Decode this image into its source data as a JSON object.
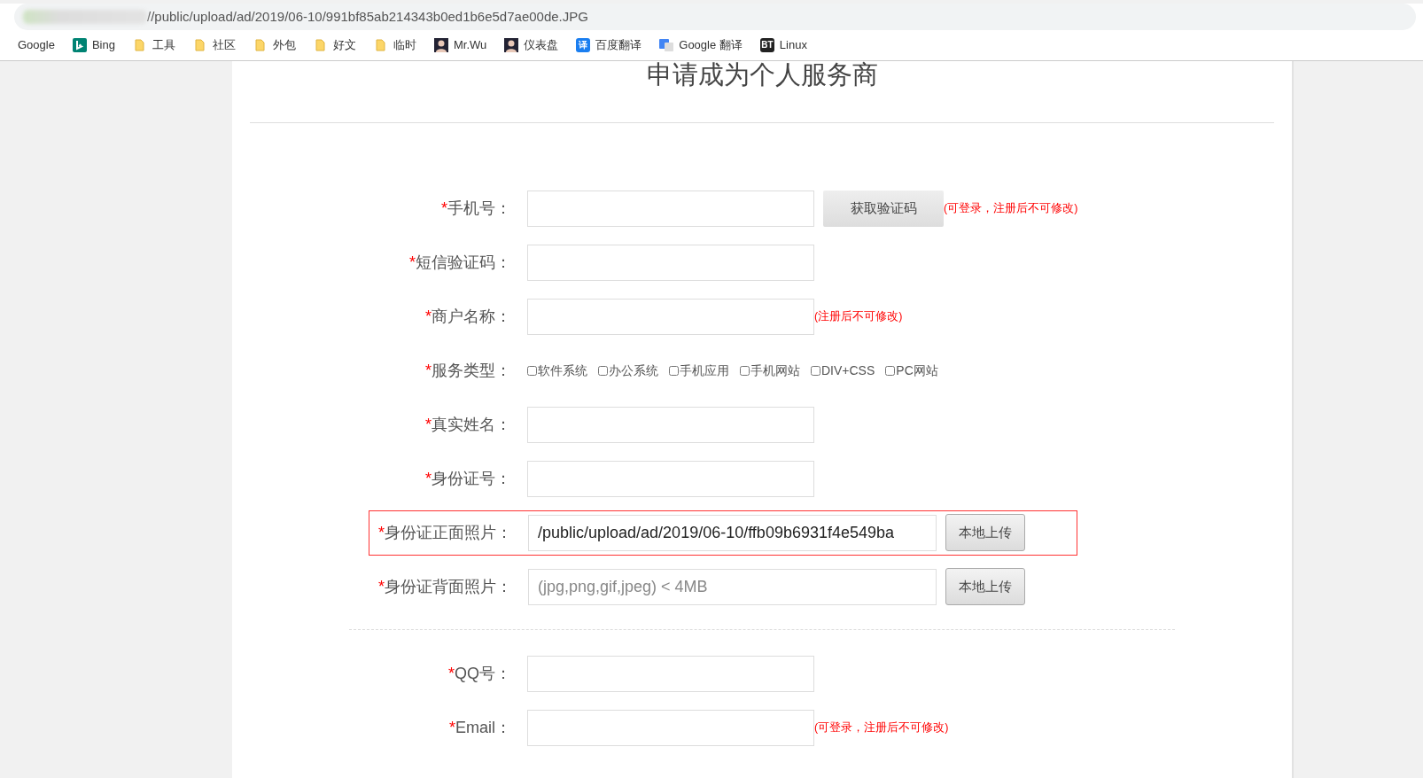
{
  "browser": {
    "url": "//public/upload/ad/2019/06-10/991bf85ab214343b0ed1b6e5d7ae00de.JPG",
    "bookmarks": [
      {
        "label": "Google",
        "kind": "plain"
      },
      {
        "label": "Bing",
        "kind": "bing"
      },
      {
        "label": "工具",
        "kind": "folder"
      },
      {
        "label": "社区",
        "kind": "folder"
      },
      {
        "label": "外包",
        "kind": "folder"
      },
      {
        "label": "好文",
        "kind": "folder"
      },
      {
        "label": "临时",
        "kind": "folder"
      },
      {
        "label": "Mr.Wu",
        "kind": "avatar"
      },
      {
        "label": "仪表盘",
        "kind": "avatar"
      },
      {
        "label": "百度翻译",
        "kind": "translate",
        "icon_text": "译"
      },
      {
        "label": "Google 翻译",
        "kind": "gtranslate"
      },
      {
        "label": "Linux",
        "kind": "terminal",
        "icon_text": "BT"
      }
    ]
  },
  "page": {
    "title": "申请成为个人服务商",
    "fields": [
      {
        "kind": "text",
        "mark": "*",
        "label": "手机号：",
        "button": "获取验证码",
        "note": "(可登录，注册后不可修改)"
      },
      {
        "kind": "text",
        "mark": "*",
        "label": "短信验证码："
      },
      {
        "kind": "text",
        "mark": "*",
        "label": "商户名称：",
        "note": "(注册后不可修改)"
      },
      {
        "kind": "checkboxes",
        "mark": "*",
        "label": "服务类型：",
        "options": [
          {
            "label": "软件系统",
            "checked": false
          },
          {
            "label": "办公系统",
            "checked": false
          },
          {
            "label": "手机应用",
            "checked": false
          },
          {
            "label": "手机网站",
            "checked": false
          },
          {
            "label": "DIV+CSS",
            "checked": false
          },
          {
            "label": "PC网站",
            "checked": false
          }
        ]
      },
      {
        "kind": "text",
        "mark": "*",
        "label": "真实姓名："
      },
      {
        "kind": "text",
        "mark": "*",
        "label": "身份证号："
      },
      {
        "kind": "upload",
        "mark": "*",
        "label": "身份证正面照片：",
        "value": "/public/upload/ad/2019/06-10/ffb09b6931f4e549ba",
        "button": "本地上传",
        "highlighted": true
      },
      {
        "kind": "upload",
        "mark": "*",
        "label": "身份证背面照片：",
        "placeholder": "(jpg,png,gif,jpeg) < 4MB",
        "button": "本地上传",
        "highlighted": false
      },
      {
        "kind": "divider"
      },
      {
        "kind": "text",
        "mark": "*",
        "label": "QQ号："
      },
      {
        "kind": "text",
        "mark": "*",
        "label": "Email：",
        "note": "(可登录，注册后不可修改)"
      }
    ]
  }
}
